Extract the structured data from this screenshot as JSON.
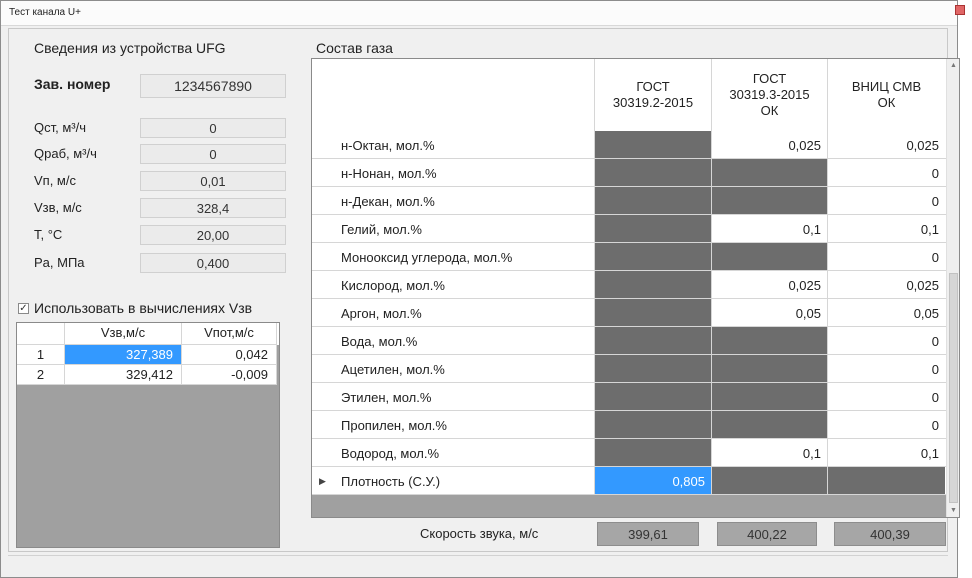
{
  "window": {
    "title": "Тест канала U+"
  },
  "device": {
    "section_title": "Сведения из устройства UFG",
    "serial_label": "Зав. номер",
    "serial_value": "1234567890",
    "params": [
      {
        "label": "Qст, м³/ч",
        "value": "0"
      },
      {
        "label": "Qраб, м³/ч",
        "value": "0"
      },
      {
        "label": "Vп, м/с",
        "value": "0,01"
      },
      {
        "label": "Vзв, м/с",
        "value": "328,4"
      },
      {
        "label": "T, °C",
        "value": "20,00"
      },
      {
        "label": "Pа, МПа",
        "value": "0,400"
      }
    ],
    "use_checkbox_label": "Использовать в вычислениях Vзв",
    "use_checkbox_checked": true
  },
  "velocity_table": {
    "headers": [
      "",
      "Vзв,м/с",
      "Vпот,м/с"
    ],
    "rows": [
      {
        "index": "1",
        "vzv": "327,389",
        "vpot": "0,042",
        "selected": true
      },
      {
        "index": "2",
        "vzv": "329,412",
        "vpot": "-0,009",
        "selected": false
      }
    ]
  },
  "gas": {
    "section_title": "Состав газа",
    "columns": [
      {
        "line1": "ГОСТ",
        "line2": "30319.2-2015",
        "line3": ""
      },
      {
        "line1": "ГОСТ",
        "line2": "30319.3-2015",
        "line3": "ОК"
      },
      {
        "line1": "ВНИЦ СМВ",
        "line2": "ОК",
        "line3": ""
      }
    ],
    "rows": [
      {
        "name": "н-Октан, мол.%",
        "c1": "",
        "c2": "0,025",
        "c3": "0,025"
      },
      {
        "name": "н-Нонан, мол.%",
        "c1": "",
        "c2": "",
        "c3": "0"
      },
      {
        "name": "н-Декан, мол.%",
        "c1": "",
        "c2": "",
        "c3": "0"
      },
      {
        "name": "Гелий, мол.%",
        "c1": "",
        "c2": "0,1",
        "c3": "0,1"
      },
      {
        "name": "Монооксид углерода, мол.%",
        "c1": "",
        "c2": "",
        "c3": "0"
      },
      {
        "name": "Кислород, мол.%",
        "c1": "",
        "c2": "0,025",
        "c3": "0,025"
      },
      {
        "name": "Аргон, мол.%",
        "c1": "",
        "c2": "0,05",
        "c3": "0,05"
      },
      {
        "name": "Вода, мол.%",
        "c1": "",
        "c2": "",
        "c3": "0"
      },
      {
        "name": "Ацетилен, мол.%",
        "c1": "",
        "c2": "",
        "c3": "0"
      },
      {
        "name": "Этилен, мол.%",
        "c1": "",
        "c2": "",
        "c3": "0"
      },
      {
        "name": "Пропилен, мол.%",
        "c1": "",
        "c2": "",
        "c3": "0"
      },
      {
        "name": "Водород, мол.%",
        "c1": "",
        "c2": "0,1",
        "c3": "0,1"
      },
      {
        "name": "Плотность (С.У.)",
        "c1": "0,805",
        "c2": "",
        "c3": ""
      }
    ],
    "sound_label": "Скорость звука, м/с",
    "sound_values": [
      "399,61",
      "400,22",
      "400,39"
    ]
  },
  "colors": {
    "disabled_cell": "#6d6d6d",
    "selection": "#3399ff",
    "grid_background": "#a0a0a0"
  }
}
